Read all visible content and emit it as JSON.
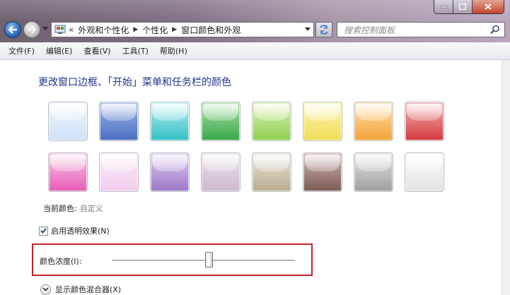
{
  "address_bar": {
    "overflow": "«",
    "crumbs": [
      "外观和个性化",
      "个性化",
      "窗口颜色和外观"
    ]
  },
  "search": {
    "placeholder": "搜索控制面板"
  },
  "menu": [
    "文件(F)",
    "编辑(E)",
    "查看(V)",
    "工具(T)",
    "帮助(H)"
  ],
  "page": {
    "heading": "更改窗口边框、「开始」菜单和任务栏的颜色",
    "current_color_label": "当前颜色:",
    "current_color_value": "自定义"
  },
  "swatches": [
    {
      "top": "#eef5fd",
      "bottom": "#cfe2f8"
    },
    {
      "top": "#9fb6e6",
      "bottom": "#4a6fc2"
    },
    {
      "top": "#b9f0f0",
      "bottom": "#33bfc4"
    },
    {
      "top": "#a8e0a8",
      "bottom": "#3aa84a"
    },
    {
      "top": "#d8f2b0",
      "bottom": "#8fd052"
    },
    {
      "top": "#fbf6b8",
      "bottom": "#f0dd55"
    },
    {
      "top": "#fde0a8",
      "bottom": "#f5a338"
    },
    {
      "top": "#f3b2b2",
      "bottom": "#d2383c"
    },
    {
      "top": "#f9c7e6",
      "bottom": "#e85cb8"
    },
    {
      "top": "#fbeefa",
      "bottom": "#f2cdee"
    },
    {
      "top": "#dccaee",
      "bottom": "#9d78c8"
    },
    {
      "top": "#ece2ec",
      "bottom": "#cbb8cc"
    },
    {
      "top": "#ebe5d8",
      "bottom": "#b9ab90"
    },
    {
      "top": "#cdb6b2",
      "bottom": "#7c5a56"
    },
    {
      "top": "#e2e2e2",
      "bottom": "#9f9f9f"
    },
    {
      "top": "#fafafa",
      "bottom": "#e4e4e4"
    }
  ],
  "transparency": {
    "label": "启用透明效果(N)",
    "checked": true
  },
  "intensity": {
    "label": "颜色浓度(I):",
    "value_fraction": 0.53
  },
  "mixer": {
    "label": "显示颜色混合器(X)"
  },
  "colors": {
    "heading": "#1e3287",
    "highlight_box": "#c0262c"
  }
}
